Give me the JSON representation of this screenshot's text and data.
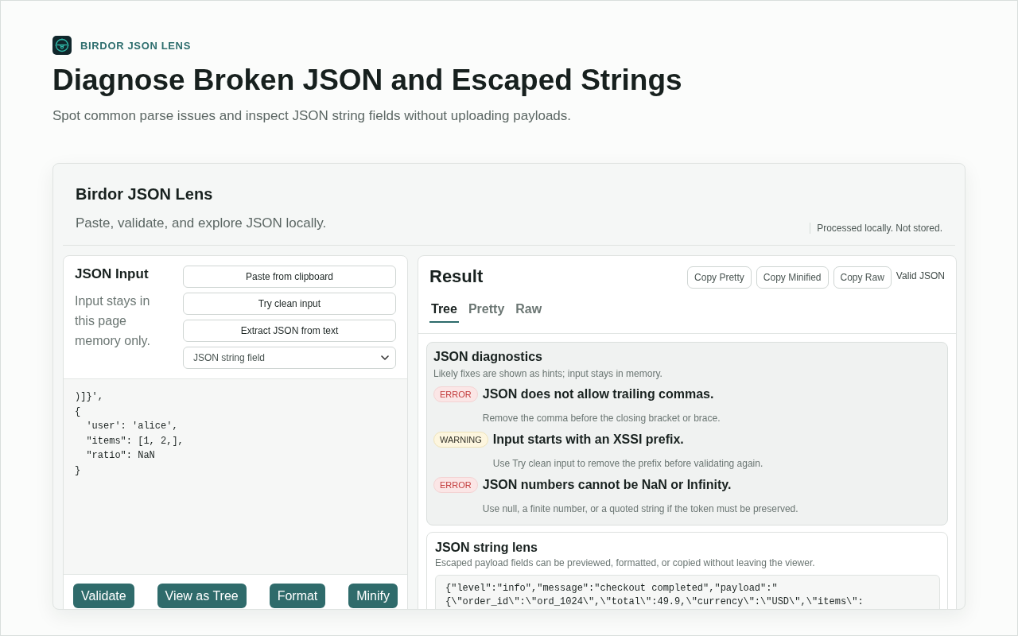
{
  "header": {
    "brand": "BIRDOR JSON LENS",
    "title": "Diagnose Broken JSON and Escaped Strings",
    "subtitle": "Spot common parse issues and inspect JSON string fields without uploading payloads."
  },
  "app": {
    "title": "Birdor JSON Lens",
    "subtitle": "Paste, validate, and explore JSON locally.",
    "privacy_note": "Processed locally. Not stored."
  },
  "input_panel": {
    "title": "JSON Input",
    "description": "Input stays in this page memory only.",
    "actions": [
      "Paste from clipboard",
      "Try clean input",
      "Extract JSON from text"
    ],
    "mode_select": {
      "value": "JSON string field"
    },
    "editor": {
      "lines": [
        ")]}',",
        "{",
        "  'user': 'alice',",
        "  \"items\": [1, 2,],",
        "  \"ratio\": NaN",
        "}"
      ]
    },
    "footer_buttons": [
      "Validate",
      "View as Tree",
      "Format",
      "Minify"
    ]
  },
  "result_panel": {
    "title": "Result",
    "copy_buttons": [
      "Copy Pretty",
      "Copy Minified",
      "Copy Raw"
    ],
    "status": "Valid JSON",
    "tabs": [
      {
        "label": "Tree",
        "selected": true
      },
      {
        "label": "Pretty",
        "selected": false
      },
      {
        "label": "Raw",
        "selected": false
      }
    ],
    "diagnostics": {
      "title": "JSON diagnostics",
      "hint": "Likely fixes are shown as hints; input stays in memory.",
      "items": [
        {
          "kind": "error",
          "badge": "ERROR",
          "message": "JSON does not allow trailing commas.",
          "hint": "Remove the comma before the closing bracket or brace."
        },
        {
          "kind": "warning",
          "badge": "WARNING",
          "message": "Input starts with an XSSI prefix.",
          "hint": "Use Try clean input to remove the prefix before validating again."
        },
        {
          "kind": "error",
          "badge": "ERROR",
          "message": "JSON numbers cannot be NaN or Infinity.",
          "hint": "Use null, a finite number, or a quoted string if the token must be preserved."
        }
      ]
    },
    "string_lens": {
      "title": "JSON string lens",
      "description": "Escaped payload fields can be previewed, formatted, or copied without leaving the viewer.",
      "code_lines": [
        "{\"level\":\"info\",\"message\":\"checkout completed\",\"payload\":\"",
        "{\\\"order_id\\\":\\\"ord_1024\\\",\\\"total\\\":49.9,\\\"currency\\\":\\\"USD\\\",\\\"items\\\":"
      ]
    }
  }
}
